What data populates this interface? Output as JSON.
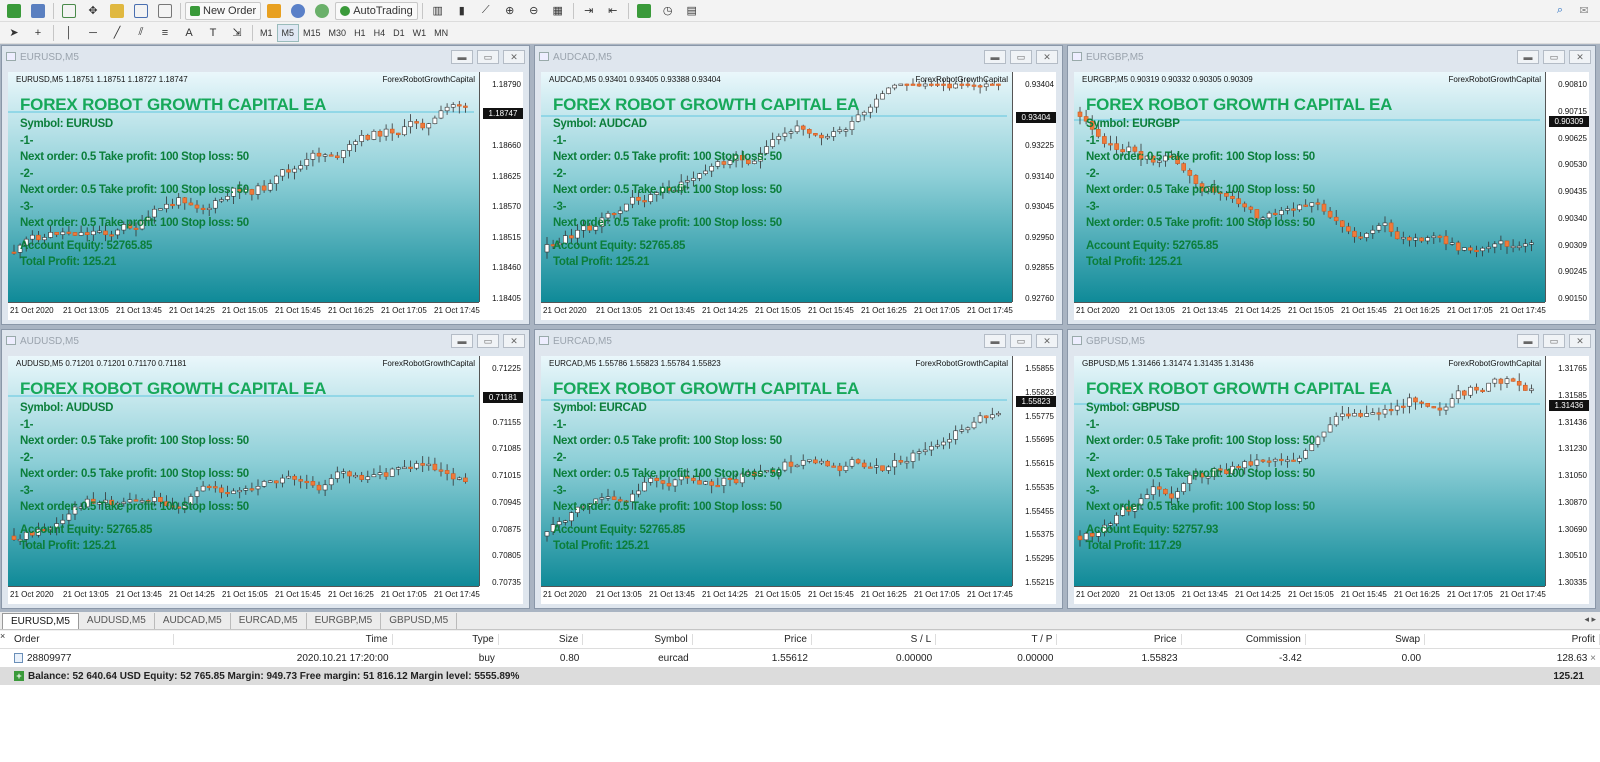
{
  "toolbar": {
    "new_order_label": "New Order",
    "autotrading_label": "AutoTrading",
    "timeframes": [
      "M1",
      "M5",
      "M15",
      "M30",
      "H1",
      "H4",
      "D1",
      "W1",
      "MN"
    ],
    "active_timeframe": "M5"
  },
  "overlay": {
    "title": "FOREX ROBOT GROWTH CAPITAL EA",
    "line1": "-1-",
    "order_line": "Next order: 0.5 Take profit: 100 Stop loss: 50",
    "line2": "-2-",
    "line3": "-3-",
    "watermark": "ForexRobotGrowthCapital"
  },
  "xlabels": [
    "21 Oct 2020",
    "21 Oct 13:05",
    "21 Oct 13:45",
    "21 Oct 14:25",
    "21 Oct 15:05",
    "21 Oct 15:45",
    "21 Oct 16:25",
    "21 Oct 17:05",
    "21 Oct 17:45"
  ],
  "charts": [
    {
      "title": "EURUSD,M5",
      "quote": "EURUSD,M5  1.18751 1.18751 1.18727 1.18747",
      "symbol": "Symbol: EURUSD",
      "equity": "Account Equity: 52765.85",
      "profit": "Total Profit: 125.21",
      "yticks": [
        "1.18790",
        "1.18747",
        "1.18660",
        "1.18625",
        "1.18570",
        "1.18515",
        "1.18460",
        "1.18405"
      ],
      "price": "1.18747"
    },
    {
      "title": "AUDCAD,M5",
      "quote": "AUDCAD,M5  0.93401 0.93405 0.93388 0.93404",
      "symbol": "Symbol: AUDCAD",
      "equity": "Account Equity: 52765.85",
      "profit": "Total Profit: 125.21",
      "yticks": [
        "0.93404",
        "0.93325",
        "0.93225",
        "0.93140",
        "0.93045",
        "0.92950",
        "0.92855",
        "0.92760"
      ],
      "price": "0.93404"
    },
    {
      "title": "EURGBP,M5",
      "quote": "EURGBP,M5  0.90319 0.90332 0.90305 0.90309",
      "symbol": "Symbol: EURGBP",
      "equity": "Account Equity: 52765.85",
      "profit": "Total Profit: 125.21",
      "yticks": [
        "0.90810",
        "0.90715",
        "0.90625",
        "0.90530",
        "0.90435",
        "0.90340",
        "0.90309",
        "0.90245",
        "0.90150"
      ],
      "price": "0.90309"
    },
    {
      "title": "AUDUSD,M5",
      "quote": "AUDUSD,M5  0.71201 0.71201 0.71170 0.71181",
      "symbol": "Symbol: AUDUSD",
      "equity": "Account Equity: 52765.85",
      "profit": "Total Profit: 125.21",
      "yticks": [
        "0.71225",
        "0.71181",
        "0.71155",
        "0.71085",
        "0.71015",
        "0.70945",
        "0.70875",
        "0.70805",
        "0.70735"
      ],
      "price": "0.71181"
    },
    {
      "title": "EURCAD,M5",
      "quote": "EURCAD,M5  1.55786 1.55823 1.55784 1.55823",
      "symbol": "Symbol: EURCAD",
      "equity": "Account Equity: 52765.85",
      "profit": "Total Profit: 125.21",
      "yticks": [
        "1.55855",
        "1.55823",
        "1.55775",
        "1.55695",
        "1.55615",
        "1.55535",
        "1.55455",
        "1.55375",
        "1.55295",
        "1.55215"
      ],
      "price": "1.55823"
    },
    {
      "title": "GBPUSD,M5",
      "quote": "GBPUSD,M5  1.31466 1.31474 1.31435 1.31436",
      "symbol": "Symbol: GBPUSD",
      "equity": "Account Equity: 52757.93",
      "profit": "Total Profit: 117.29",
      "yticks": [
        "1.31765",
        "1.31585",
        "1.31436",
        "1.31230",
        "1.31050",
        "1.30870",
        "1.30690",
        "1.30510",
        "1.30335"
      ],
      "price": "1.31436"
    }
  ],
  "tabs": [
    "EURUSD,M5",
    "AUDUSD,M5",
    "AUDCAD,M5",
    "EURCAD,M5",
    "EURGBP,M5",
    "GBPUSD,M5"
  ],
  "terminal": {
    "headers": [
      "Order",
      "Time",
      "Type",
      "Size",
      "Symbol",
      "Price",
      "S / L",
      "T / P",
      "Price",
      "Commission",
      "Swap",
      "Profit"
    ],
    "row": [
      "28809977",
      "2020.10.21 17:20:00",
      "buy",
      "0.80",
      "eurcad",
      "1.55612",
      "0.00000",
      "0.00000",
      "1.55823",
      "-3.42",
      "0.00",
      "128.63"
    ],
    "balance": "Balance: 52 640.64 USD  Equity: 52 765.85  Margin: 949.73  Free margin: 51 816.12  Margin level: 5555.89%",
    "balance_profit": "125.21"
  },
  "colors": {
    "bull": "#ffffff",
    "bear": "#f07a3a",
    "overlay_text": "#0b7e3a",
    "title_text": "#17a85a",
    "plot_top": "#eaf7fb",
    "plot_bottom": "#0f8a98"
  }
}
